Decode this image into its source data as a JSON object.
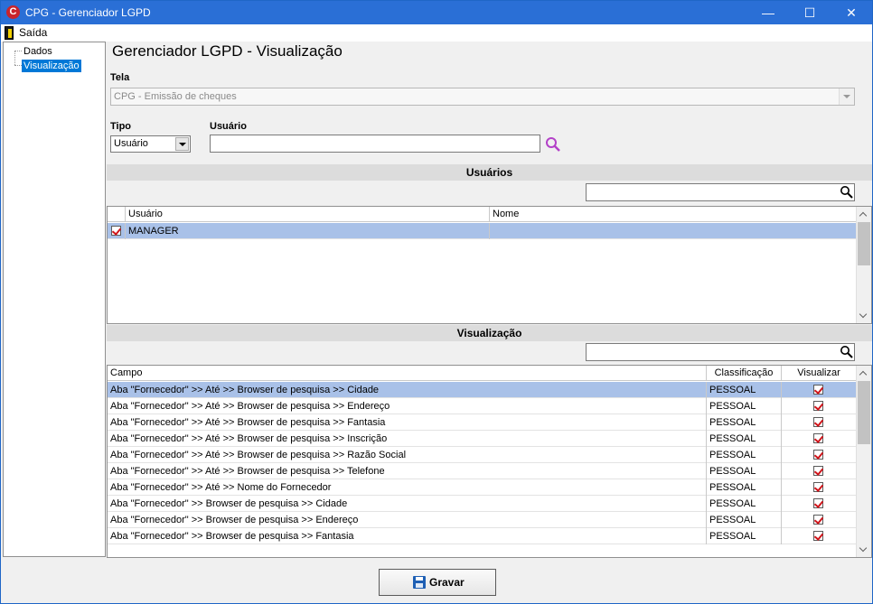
{
  "window": {
    "title": "CPG - Gerenciador LGPD",
    "controls": {
      "minimize": "—",
      "maximize": "☐",
      "close": "✕"
    }
  },
  "menu": {
    "exit_label": "Saída"
  },
  "tree": {
    "items": [
      {
        "label": "Dados",
        "selected": false
      },
      {
        "label": "Visualização",
        "selected": true
      }
    ]
  },
  "page": {
    "title": "Gerenciador LGPD - Visualização",
    "tela_label": "Tela",
    "tela_value": "CPG - Emissão de cheques",
    "tipo_label": "Tipo",
    "tipo_value": "Usuário",
    "usuario_label": "Usuário",
    "usuario_value": ""
  },
  "users_section": {
    "header": "Usuários",
    "filter_value": "",
    "columns": [
      "Usuário",
      "Nome"
    ],
    "rows": [
      {
        "checked": true,
        "usuario": "MANAGER",
        "nome": ""
      }
    ]
  },
  "view_section": {
    "header": "Visualização",
    "filter_value": "",
    "columns": [
      "Campo",
      "Classificação",
      "Visualizar"
    ],
    "rows": [
      {
        "campo": "Aba \"Fornecedor\" >> Até >> Browser de pesquisa >> Cidade",
        "classificacao": "PESSOAL",
        "visualizar": true
      },
      {
        "campo": "Aba \"Fornecedor\" >> Até >> Browser de pesquisa >> Endereço",
        "classificacao": "PESSOAL",
        "visualizar": true
      },
      {
        "campo": "Aba \"Fornecedor\" >> Até >> Browser de pesquisa >> Fantasia",
        "classificacao": "PESSOAL",
        "visualizar": true
      },
      {
        "campo": "Aba \"Fornecedor\" >> Até >> Browser de pesquisa >> Inscrição",
        "classificacao": "PESSOAL",
        "visualizar": true
      },
      {
        "campo": "Aba \"Fornecedor\" >> Até >> Browser de pesquisa >> Razão Social",
        "classificacao": "PESSOAL",
        "visualizar": true
      },
      {
        "campo": "Aba \"Fornecedor\" >> Até >> Browser de pesquisa >> Telefone",
        "classificacao": "PESSOAL",
        "visualizar": true
      },
      {
        "campo": "Aba \"Fornecedor\" >> Até >> Nome do Fornecedor",
        "classificacao": "PESSOAL",
        "visualizar": true
      },
      {
        "campo": "Aba \"Fornecedor\" >> Browser de pesquisa >> Cidade",
        "classificacao": "PESSOAL",
        "visualizar": true
      },
      {
        "campo": "Aba \"Fornecedor\" >> Browser de pesquisa >> Endereço",
        "classificacao": "PESSOAL",
        "visualizar": true
      },
      {
        "campo": "Aba \"Fornecedor\" >> Browser de pesquisa >> Fantasia",
        "classificacao": "PESSOAL",
        "visualizar": true
      }
    ]
  },
  "actions": {
    "save_label": "Gravar"
  },
  "colors": {
    "titlebar": "#2a6fd6",
    "selection": "#a9c1e8",
    "check": "#d0141a"
  }
}
